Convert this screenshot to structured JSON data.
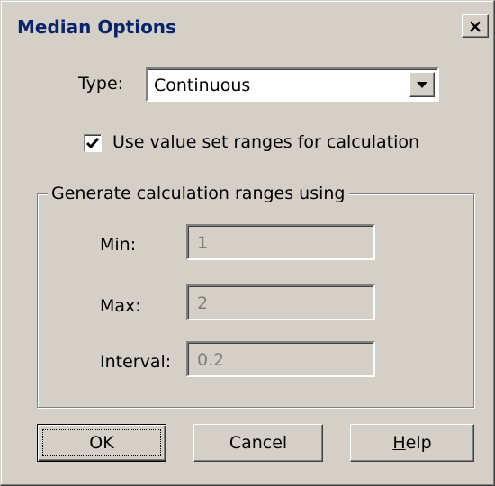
{
  "window": {
    "title": "Median Options",
    "close_glyph": "×"
  },
  "type_field": {
    "label": "Type:",
    "selected": "Continuous"
  },
  "checkbox": {
    "label": "Use value set ranges for calculation",
    "checked": true
  },
  "group": {
    "legend": "Generate calculation ranges using",
    "min_label": "Min:",
    "min_value": "1",
    "max_label": "Max:",
    "max_value": "2",
    "interval_label": "Interval:",
    "interval_value": "0.2"
  },
  "buttons": {
    "ok": "OK",
    "cancel": "Cancel",
    "help_mnemonic": "H",
    "help_rest": "elp"
  },
  "colors": {
    "title_text": "#0a246a",
    "face": "#d4d0c8",
    "disabled_text": "#808080"
  }
}
